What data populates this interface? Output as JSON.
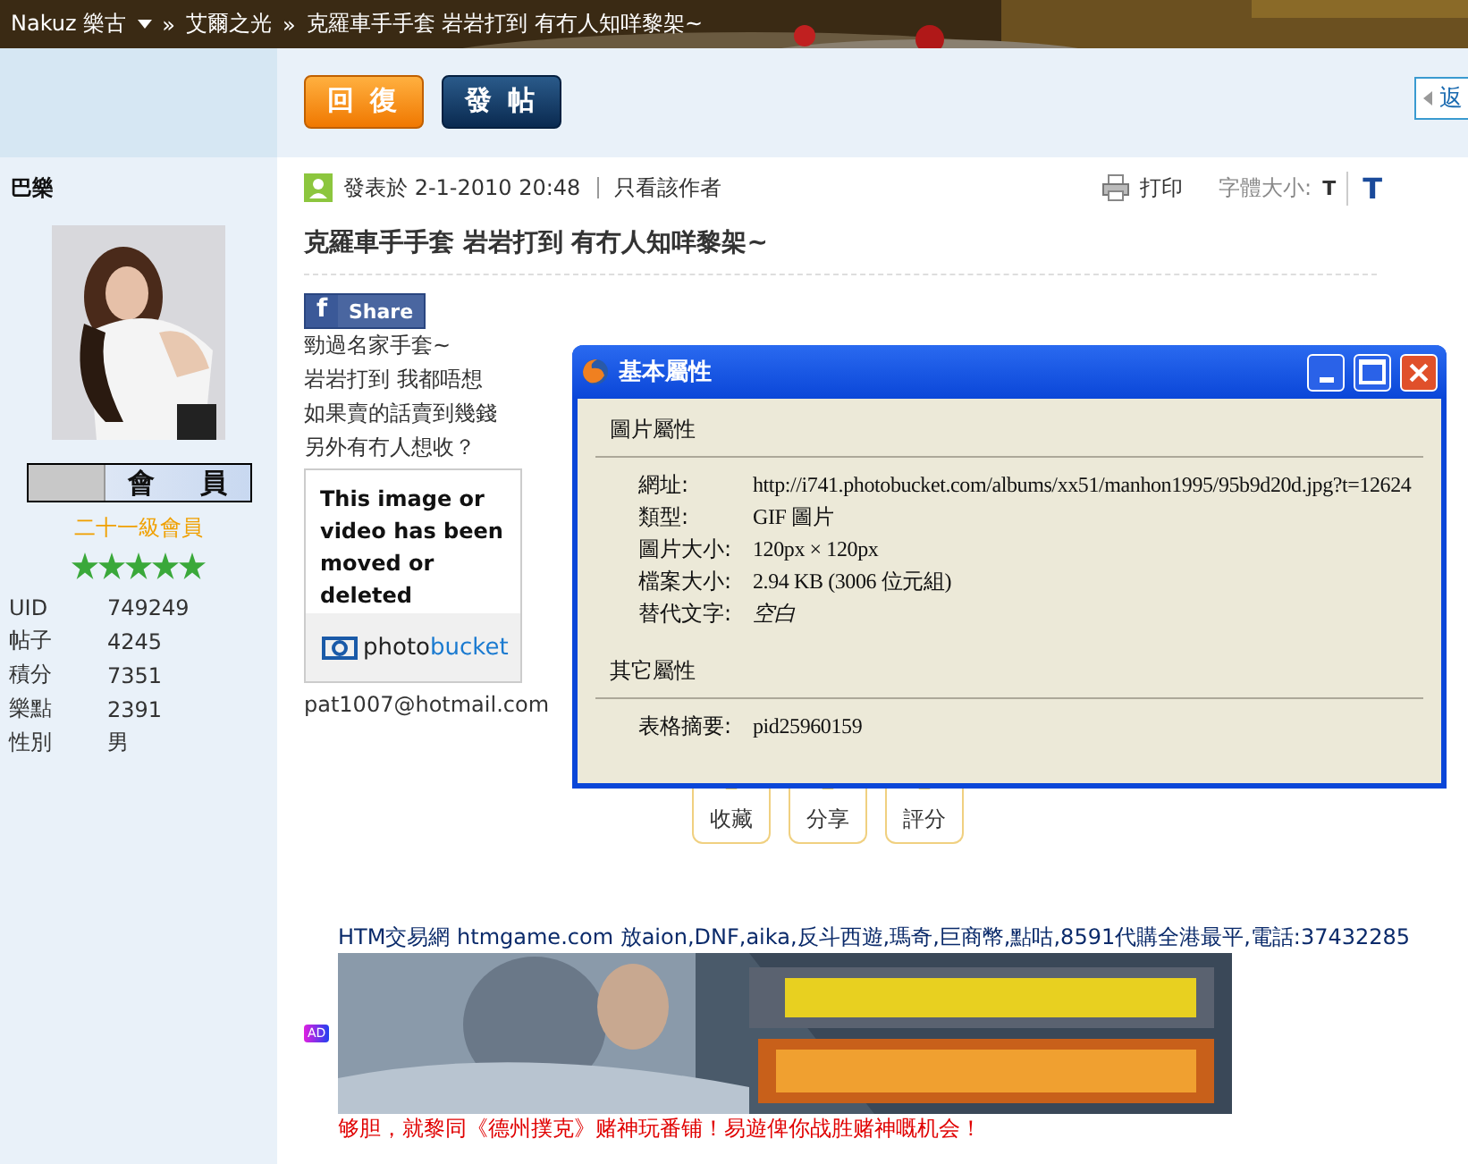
{
  "breadcrumb": {
    "user": "Nakuz 樂古",
    "separator": "»",
    "items": [
      "艾爾之光",
      "克羅車手手套 岩岩打到 有冇人知咩黎架~"
    ]
  },
  "toolbar": {
    "buttons": [
      {
        "label": "回 復",
        "kind": "reply"
      },
      {
        "label": "發 帖",
        "kind": "post"
      }
    ],
    "back_link": "返"
  },
  "author": {
    "name": "巴樂",
    "badge": [
      "會",
      "員"
    ],
    "rank": "二十一級會員",
    "stars": 5,
    "stats": [
      {
        "label": "UID",
        "value": "749249"
      },
      {
        "label": "帖子",
        "value": "4245"
      },
      {
        "label": "積分",
        "value": "7351"
      },
      {
        "label": "樂點",
        "value": "2391"
      },
      {
        "label": "性別",
        "value": "男"
      }
    ]
  },
  "post": {
    "posted": "發表於 2-1-2010 20:48",
    "only_author": "只看該作者",
    "print": "打印",
    "font_size_label": "字體大小:",
    "font_sizes": [
      "T",
      "T"
    ],
    "title": "克羅車手手套 岩岩打到 有冇人知咩黎架~",
    "share_icon": "f",
    "share": "Share",
    "body": [
      "勁過名家手套~",
      "岩岩打到 我都唔想",
      "如果賣的話賣到幾錢",
      "另外有冇人想收？"
    ],
    "missing_image": {
      "message": "This image or video has been moved or deleted",
      "brand_prefix": "photo",
      "brand_suffix": "bucket"
    },
    "email": "pat1007@hotmail.com",
    "actions": [
      "收藏",
      "分享",
      "評分"
    ]
  },
  "dialog": {
    "title": "基本屬性",
    "sections": [
      {
        "heading": "圖片屬性",
        "rows": [
          {
            "label": "網址:",
            "value": "http://i741.photobucket.com/albums/xx51/manhon1995/95b9d20d.jpg?t=12624",
            "italic": false
          },
          {
            "label": "類型:",
            "value": "GIF 圖片",
            "italic": false
          },
          {
            "label": "圖片大小:",
            "value": "120px × 120px",
            "italic": false
          },
          {
            "label": "檔案大小:",
            "value": "2.94 KB (3006 位元組)",
            "italic": false
          },
          {
            "label": "替代文字:",
            "value": "空白",
            "italic": true
          }
        ]
      },
      {
        "heading": "其它屬性",
        "rows": [
          {
            "label": "表格摘要:",
            "value": "pid25960159",
            "italic": false
          }
        ]
      }
    ]
  },
  "ad": {
    "link": "HTM交易網 htmgame.com 放aion,DNF,aika,反斗西遊,瑪奇,巨商幣,點咕,8591代購全港最平,電話:37432285",
    "tag": "AD",
    "promo": "够胆，就黎同《德州撲克》赌神玩番铺！易遊俾你战胜赌神嘅机会！"
  }
}
